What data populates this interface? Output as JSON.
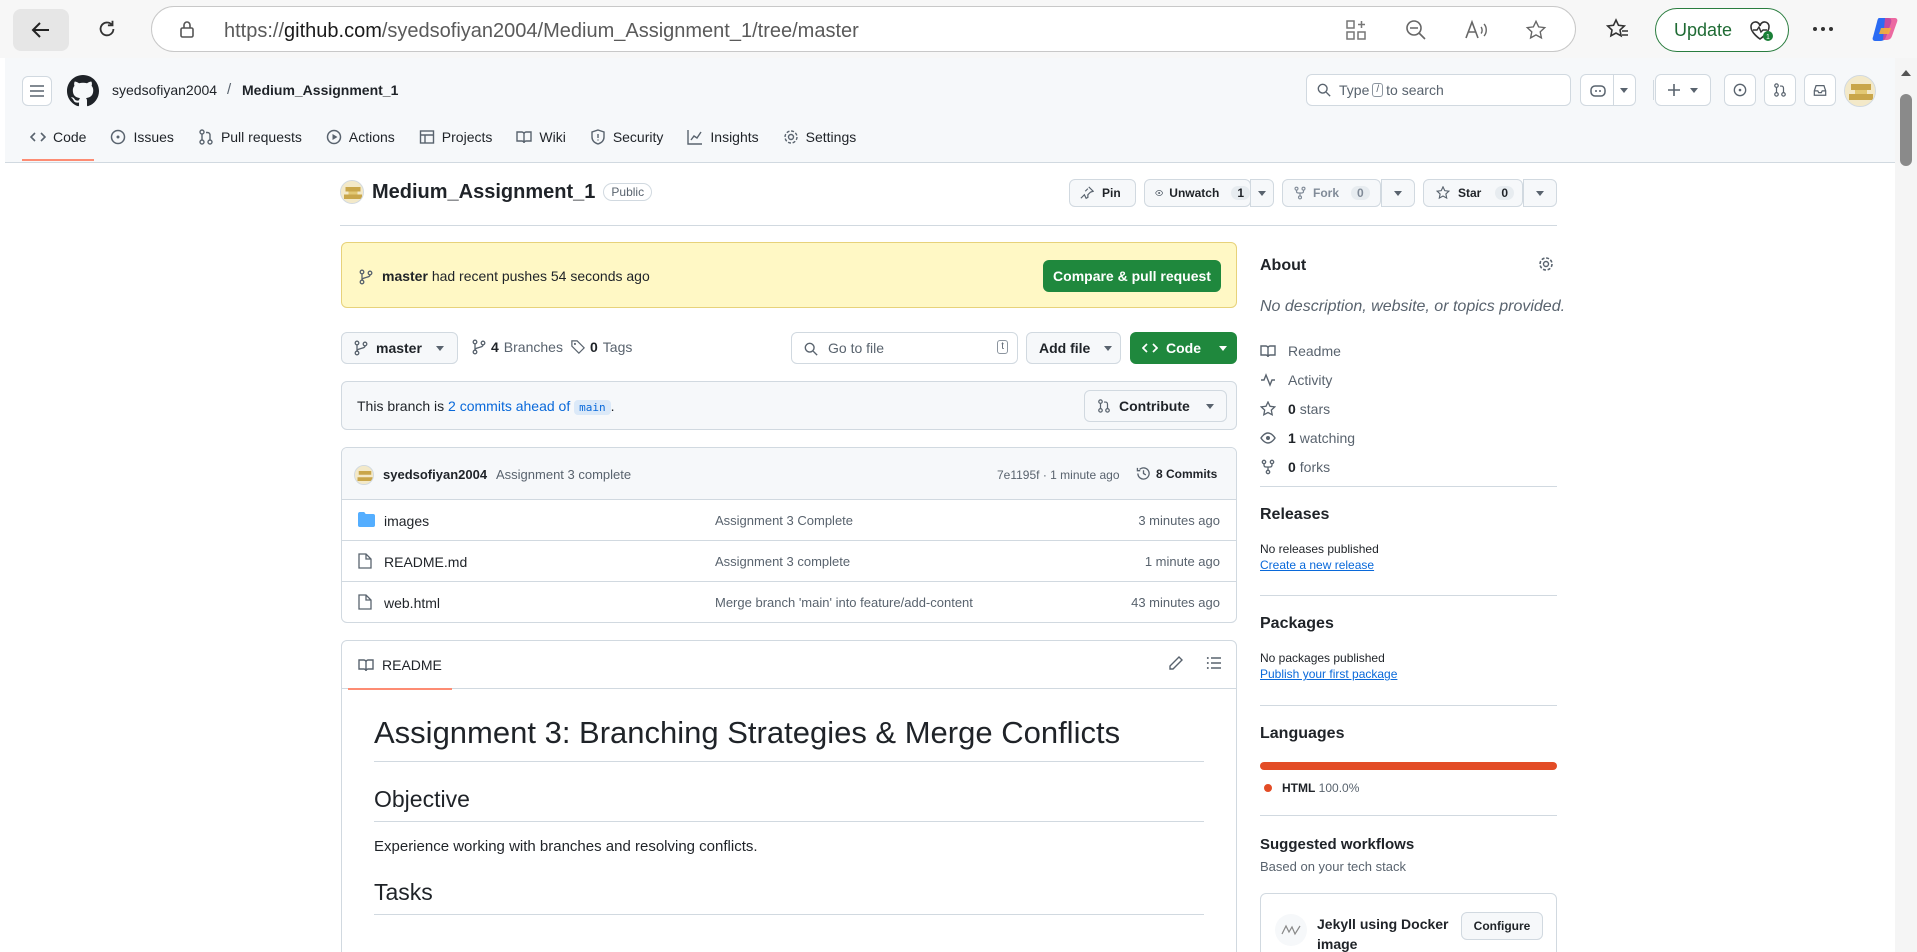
{
  "browser": {
    "url_prefix": "https://",
    "url_host": "github.com",
    "url_path": "/syedsofiyan2004/Medium_Assignment_1/tree/master",
    "update_label": "Update"
  },
  "header": {
    "owner": "syedsofiyan2004",
    "separator": "/",
    "repo": "Medium_Assignment_1",
    "search_prefix": "Type",
    "search_key": "/",
    "search_suffix": "to search"
  },
  "nav": {
    "tabs": [
      {
        "label": "Code",
        "icon": "code-icon",
        "active": true
      },
      {
        "label": "Issues",
        "icon": "issue-icon"
      },
      {
        "label": "Pull requests",
        "icon": "pull-request-icon"
      },
      {
        "label": "Actions",
        "icon": "play-icon"
      },
      {
        "label": "Projects",
        "icon": "table-icon"
      },
      {
        "label": "Wiki",
        "icon": "book-icon"
      },
      {
        "label": "Security",
        "icon": "shield-icon"
      },
      {
        "label": "Insights",
        "icon": "graph-icon"
      },
      {
        "label": "Settings",
        "icon": "gear-icon"
      }
    ]
  },
  "repo": {
    "name": "Medium_Assignment_1",
    "visibility": "Public",
    "pin_label": "Pin",
    "watch_label": "Unwatch",
    "watch_count": "1",
    "fork_label": "Fork",
    "fork_count": "0",
    "star_label": "Star",
    "star_count": "0"
  },
  "banner": {
    "branch": "master",
    "text": "had recent pushes 54 seconds ago",
    "button": "Compare & pull request"
  },
  "toolbar": {
    "branch": "master",
    "branches_count": "4",
    "branches_label": "Branches",
    "tags_count": "0",
    "tags_label": "Tags",
    "goto_placeholder": "Go to file",
    "goto_key": "t",
    "add_file": "Add file",
    "code": "Code"
  },
  "ahead": {
    "prefix": "This branch is",
    "link": "2 commits ahead of",
    "base": "main",
    "suffix": ".",
    "contribute": "Contribute"
  },
  "commit": {
    "author": "syedsofiyan2004",
    "message": "Assignment 3 complete",
    "sha_time": "7e1195f · 1 minute ago",
    "commits_label": "8 Commits"
  },
  "files": [
    {
      "name": "images",
      "type": "folder",
      "message": "Assignment 3 Complete",
      "time": "3 minutes ago"
    },
    {
      "name": "README.md",
      "type": "file",
      "message": "Assignment 3 complete",
      "time": "1 minute ago"
    },
    {
      "name": "web.html",
      "type": "file",
      "message": "Merge branch 'main' into feature/add-content",
      "time": "43 minutes ago"
    }
  ],
  "readme": {
    "tab": "README",
    "h1": "Assignment 3: Branching Strategies & Merge Conflicts",
    "h2_objective": "Objective",
    "objective_text": "Experience working with branches and resolving conflicts.",
    "h2_tasks": "Tasks"
  },
  "sidebar": {
    "about_title": "About",
    "about_desc": "No description, website, or topics provided.",
    "about_items": [
      {
        "icon": "book-icon",
        "count": "",
        "label": "Readme"
      },
      {
        "icon": "pulse-icon",
        "count": "",
        "label": "Activity"
      },
      {
        "icon": "star-icon",
        "count": "0",
        "label": "stars"
      },
      {
        "icon": "eye-icon",
        "count": "1",
        "label": "watching"
      },
      {
        "icon": "fork-icon",
        "count": "0",
        "label": "forks"
      }
    ],
    "releases_title": "Releases",
    "releases_text": "No releases published",
    "releases_link": "Create a new release",
    "packages_title": "Packages",
    "packages_text": "No packages published",
    "packages_link": "Publish your first package",
    "languages_title": "Languages",
    "language_name": "HTML",
    "language_pct": "100.0%",
    "language_color": "#e34c26",
    "workflows_title": "Suggested workflows",
    "workflows_sub": "Based on your tech stack",
    "workflow_name": "Jekyll using Docker image",
    "workflow_button": "Configure"
  },
  "colors": {
    "accent_green": "#1f883d",
    "banner_yellow": "#fff8c5",
    "tab_underline": "#fd8c73",
    "link_blue": "#0969da"
  }
}
